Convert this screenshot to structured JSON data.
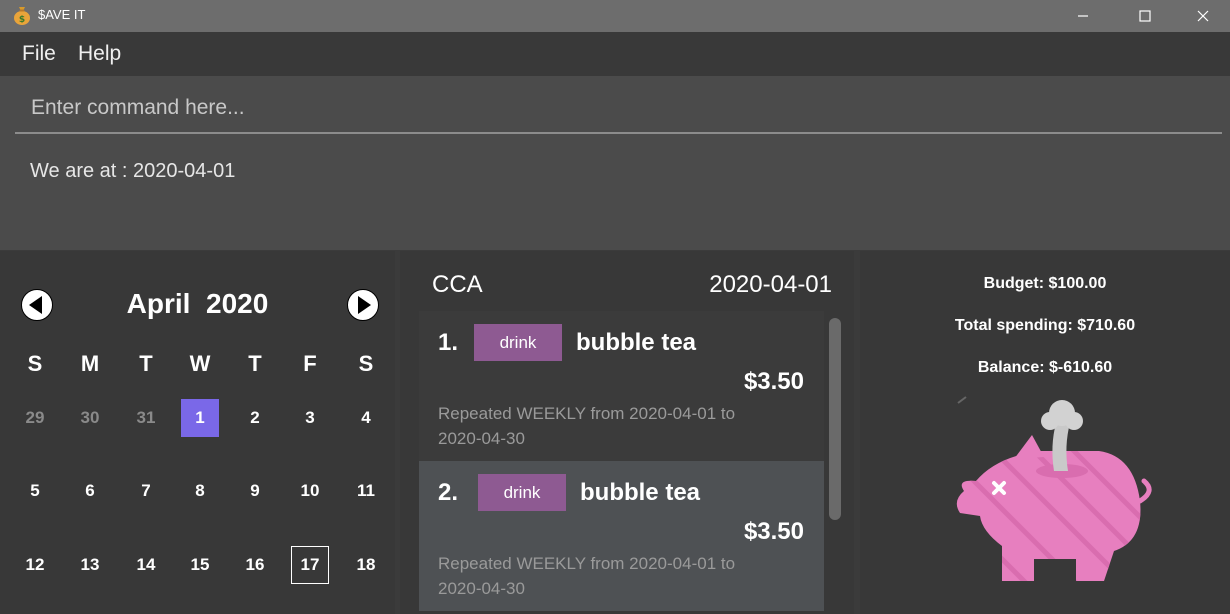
{
  "window": {
    "title": "$AVE IT",
    "icons": {
      "app": "money-bag-icon",
      "minimize": "minimize-icon",
      "maximize": "maximize-icon",
      "close": "close-icon"
    }
  },
  "menu": {
    "file": "File",
    "help": "Help"
  },
  "command": {
    "placeholder": "Enter command here...",
    "value": ""
  },
  "result": {
    "text": "We are at : 2020-04-01"
  },
  "calendar": {
    "month": "April",
    "year": "2020",
    "weekdays": [
      "S",
      "M",
      "T",
      "W",
      "T",
      "F",
      "S"
    ],
    "rows": [
      [
        "29",
        "30",
        "31",
        "1",
        "2",
        "3",
        "4"
      ],
      [
        "5",
        "6",
        "7",
        "8",
        "9",
        "10",
        "11"
      ],
      [
        "12",
        "13",
        "14",
        "15",
        "16",
        "17",
        "18"
      ]
    ],
    "selected_day": "1",
    "today_day": "17",
    "colors": {
      "selected": "#7a68e8"
    }
  },
  "expenses": {
    "category": "CCA",
    "date": "2020-04-01",
    "items": [
      {
        "index": "1.",
        "tag": "drink",
        "name": "bubble tea",
        "amount": "$3.50",
        "repeat": "Repeated WEEKLY from 2020-04-01 to 2020-04-30"
      },
      {
        "index": "2.",
        "tag": "drink",
        "name": "bubble tea",
        "amount": "$3.50",
        "repeat": "Repeated WEEKLY from 2020-04-01 to 2020-04-30"
      }
    ],
    "colors": {
      "tag": "#8e5a92",
      "selected_row": "#4e5154"
    }
  },
  "summary": {
    "budget": "Budget: $100.00",
    "spending": "Total spending: $710.60",
    "balance": "Balance: $-610.60",
    "illustration": "piggy-bank-icon",
    "colors": {
      "pig": "#e77fbf"
    }
  }
}
